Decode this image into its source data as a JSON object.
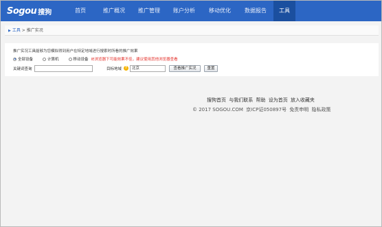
{
  "header": {
    "logo_word": "Sogou",
    "logo_cn": "搜狗",
    "nav": [
      {
        "label": "首页",
        "active": false
      },
      {
        "label": "推广概况",
        "active": false
      },
      {
        "label": "推广管理",
        "active": false
      },
      {
        "label": "账户分析",
        "active": false
      },
      {
        "label": "移动优化",
        "active": false
      },
      {
        "label": "数据报告",
        "active": false
      },
      {
        "label": "工具",
        "active": true
      }
    ]
  },
  "breadcrumb": {
    "root": "工具",
    "separator": ">",
    "current": "推广实况"
  },
  "tool": {
    "description": "推广实况工具能够为您模拟得到用户在特定地域进行搜索时所看的推广效果",
    "radios": [
      {
        "label": "全部设备",
        "checked": true
      },
      {
        "label": "计算机",
        "checked": false
      },
      {
        "label": "移动设备",
        "checked": false
      }
    ],
    "warning": "IE浏览器下可能效果不佳，建议使用其他浏览器查看",
    "keyword_label": "关键词查询",
    "keyword_value": "",
    "region_label": "目标地域",
    "region_value": "北京",
    "view_button": "查看推广实况",
    "reset_button": "重置"
  },
  "footer": {
    "links": [
      "搜狗首页",
      "与我们联系",
      "帮助",
      "设为首页",
      "放入收藏夹"
    ],
    "copyright": "© 2017 SOGOU.COM",
    "icp": "京ICP证050897号",
    "disclaimer": "免责申明",
    "privacy": "隐私政策"
  },
  "colors": {
    "nav_bg": "#2c66c4",
    "nav_active": "#1b4f9f",
    "warning": "#e4302a"
  }
}
